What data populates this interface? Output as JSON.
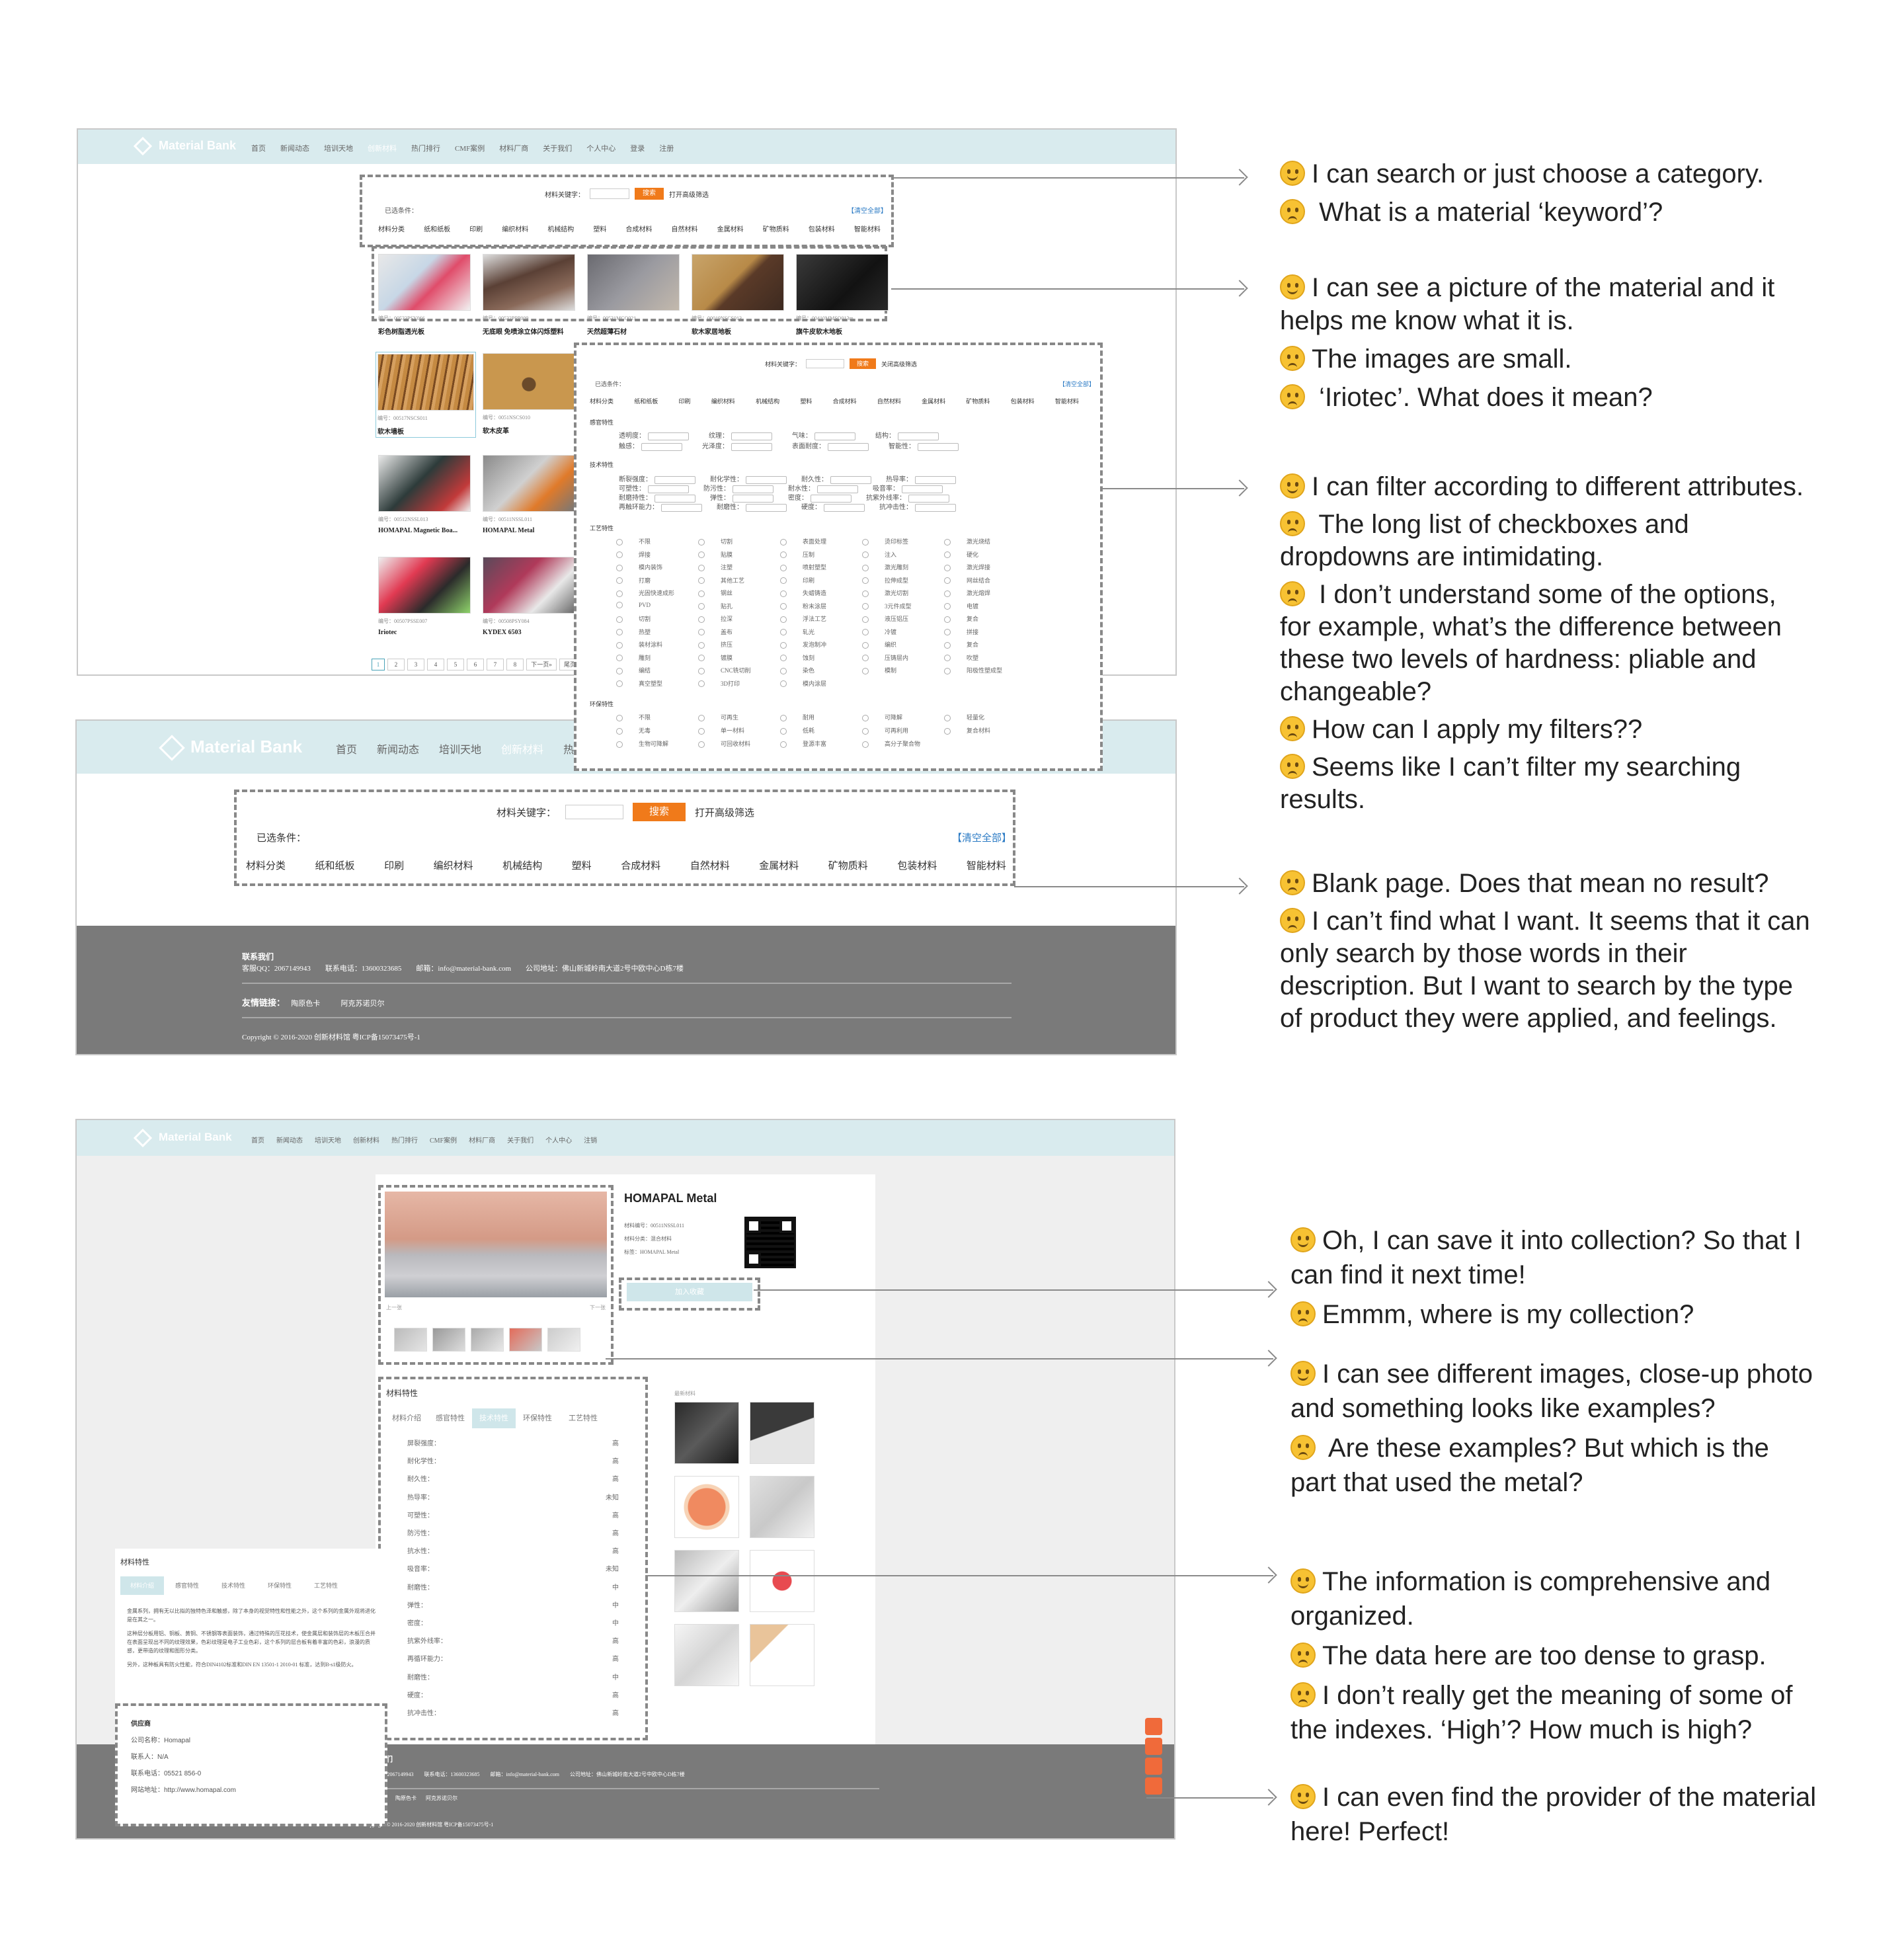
{
  "site": {
    "logo": "Material Bank",
    "nav": [
      "首页",
      "新闻动态",
      "培训天地",
      "创新材料",
      "热门排行",
      "CMF案例",
      "材料厂商",
      "关于我们",
      "个人中心",
      "登录",
      "注册"
    ],
    "nav_bottom": [
      "首页",
      "新闻动态",
      "培训天地",
      "创新材料",
      "热门排行",
      "CMF案例",
      "材料厂商",
      "关于我们",
      "个人中心",
      "注销"
    ]
  },
  "search": {
    "keyword_label": "材料关键字：",
    "button": "搜索",
    "advanced_open": "打开高级筛选",
    "advanced_close": "关闭高级筛选",
    "selected_label": "已选条件：",
    "clear_all": "【清空全部】",
    "categories": [
      "材料分类",
      "纸和纸板",
      "印刷",
      "编织材料",
      "机械结构",
      "塑料",
      "合成材料",
      "自然材料",
      "金属材料",
      "矿物质料",
      "包装材料",
      "智能材料"
    ]
  },
  "results": [
    {
      "code": "编号：00533PSY066",
      "name": "彩色树脂透光板"
    },
    {
      "code": "编号：00532PPP009",
      "name": "无底眼 免喷涂立体闪烁塑料"
    },
    {
      "code": "编号：00531MCO021",
      "name": "天然超薄石材"
    },
    {
      "code": "编号：00019NSCS013",
      "name": "软木家居地板"
    },
    {
      "code": "编号：00410MMSO013m",
      "name": "旗牛皮软木地板"
    },
    {
      "code": "编号：00517NSCS011",
      "name": "软木墙板"
    },
    {
      "code": "编号：0051NSCS010",
      "name": "软木皮革"
    },
    {
      "code": "编号：00512NSSL013",
      "name": "HOMAPAL Magnetic Boa..."
    },
    {
      "code": "编号：00511NSSL011",
      "name": "HOMAPAL Metal"
    },
    {
      "code": "编号：00507PSSE007",
      "name": "Iriotec"
    },
    {
      "code": "编号：00508PSY084",
      "name": "KYDEX 6503"
    }
  ],
  "pager": [
    "1",
    "2",
    "3",
    "4",
    "5",
    "6",
    "7",
    "8",
    "下一页»",
    "尾页"
  ],
  "filters": {
    "sensory_title": "感官特性",
    "sensory": [
      "透明度：",
      "纹理：",
      "气味：",
      "结构：",
      "触感：",
      "光泽度：",
      "表面耐度：",
      "智能性："
    ],
    "dropdown": "不限",
    "tech_title": "技术特性",
    "tech": [
      "断裂强度：",
      "耐化学性：",
      "耐久性：",
      "热导率：",
      "可塑性：",
      "防污性：",
      "耐水性：",
      "吸音率：",
      "耐磨持性：",
      "弹性：",
      "密度：",
      "抗紫外线率：",
      "再触环能力：",
      "耐磨性：",
      "硬度：",
      "抗冲击性："
    ],
    "process_title": "工艺特性",
    "process": [
      "不限",
      "切割",
      "表面处理",
      "烫印标签",
      "激光烧结",
      "焊接",
      "贴膜",
      "压制",
      "注入",
      "硬化",
      "模内装饰",
      "注塑",
      "喷射塑型",
      "激光雕刻",
      "激光焊接",
      "打磨",
      "其他工艺",
      "印刷",
      "拉伸成型",
      "网丝结合",
      "光固快速成形",
      "钢丝",
      "失蜡铸造",
      "激光切割",
      "激光熔焊",
      "PVD",
      "贴孔",
      "粉末涂层",
      "3元件成型",
      "电镀",
      "切割",
      "拉深",
      "浮法工艺",
      "液压铝压",
      "复合",
      "热塑",
      "盖布",
      "轧光",
      "冷镀",
      "拼接",
      "装材涂料",
      "挤压",
      "发泡制冲",
      "编织",
      "复合",
      "雕刻",
      "镀膜",
      "蚀刻",
      "压铸层内",
      "吹塑",
      "编结",
      "CNC铣切削",
      "染色",
      "模制",
      "阳极性塑成型",
      "真空塑型",
      "3D打印",
      "模内涂层"
    ],
    "eco_title": "环保特性",
    "eco": [
      "不限",
      "可再生",
      "耐用",
      "可降解",
      "轻量化",
      "无毒",
      "单一材料",
      "低耗",
      "可再利用",
      "复合材料",
      "生物可降解",
      "可回收材料",
      "登源丰富",
      "高分子聚合物"
    ]
  },
  "footer": {
    "title": "联系我们",
    "contact": "客服QQ：2067149943　　联系电话：13600323685　　邮箱：info@material-bank.com　　公司地址：佛山新城岭南大道2号中欧中心D栋7楼",
    "links_label": "友情链接：",
    "links": [
      "陶原色卡",
      "阿克苏诺贝尔"
    ],
    "copyright": "Copyright © 2016-2020 创新材料馆 粤ICP备15073475号-1"
  },
  "detail": {
    "title": "HOMAPAL Metal",
    "meta": [
      "材料编号：00511NSSL011",
      "材料分类：混合材料",
      "标签：HOMAPAL Metal"
    ],
    "save": "加入收藏",
    "prev": "上一张",
    "next": "下一张",
    "section_title": "材料特性",
    "tabs": [
      "材料介绍",
      "感官特性",
      "技术特性",
      "环保特性",
      "工艺特性"
    ],
    "props": [
      {
        "k": "屏裂强度：",
        "v": "高"
      },
      {
        "k": "耐化学性：",
        "v": "高"
      },
      {
        "k": "耐久性：",
        "v": "高"
      },
      {
        "k": "热导率：",
        "v": "未知"
      },
      {
        "k": "可塑性：",
        "v": "高"
      },
      {
        "k": "防污性：",
        "v": "高"
      },
      {
        "k": "抗水性：",
        "v": "高"
      },
      {
        "k": "吸音率：",
        "v": "未知"
      },
      {
        "k": "耐磨性：",
        "v": "中"
      },
      {
        "k": "弹性：",
        "v": "中"
      },
      {
        "k": "密度：",
        "v": "中"
      },
      {
        "k": "抗紫外线率：",
        "v": "高"
      },
      {
        "k": "再循环能力：",
        "v": "高"
      },
      {
        "k": "耐磨性：",
        "v": "中"
      },
      {
        "k": "硬度：",
        "v": "高"
      },
      {
        "k": "抗冲击性：",
        "v": "高"
      }
    ],
    "similar_title": "最新材料",
    "intro_text": "金属系列，拥有无以比拟的独特色泽和触感，除了本身的视觉特性和性能之外，这个系列的金属外观将进化是在其之一。",
    "intro_text2": "这种层分板用铝、铜板、黄铜、不锈钢等表面装饰，通过特殊的压花技术，使金属层和装饰层的木板压合并在表面呈现出不同的纹理效果，色彩纹理是电子工业色彩，这个系列的层合板有着丰富的色彩，浪漫的质感，更带造的纹理和图形分类。",
    "intro_text3": "另外，这种板具有防火性能，符合DIN4102标准和DIN EN 13501-1 2010-01 标准，达到B-s1级防火。",
    "supplier_title": "供应商",
    "supplier": [
      "公司名称：Homapal",
      "联系人：N/A",
      "联系电话：05521 856-0",
      "网站地址：http://www.homapal.com"
    ]
  },
  "notes": {
    "n1": [
      "I can search or just choose a category.",
      "What is a material ‘keyword’?"
    ],
    "n2": [
      "I can see a picture of the material and it",
      "helps me know what it is.",
      "The images are small.",
      "‘Iriotec’. What does it mean?"
    ],
    "n3": [
      "I can filter according to different attributes.",
      "The long list of checkboxes and",
      "dropdowns are intimidating.",
      "I don’t understand some of the options,",
      "for example, what’s the difference between",
      "these two levels of hardness:  pliable and",
      "changeable?",
      "How can I apply my filters??",
      "Seems like I can’t filter my searching",
      "results."
    ],
    "n4": [
      "Blank page. Does that mean no result?",
      "I can’t find what I want. It seems that it can",
      "only search by those words in their",
      "description. But I want to search by the type",
      "of product they were applied, and feelings."
    ],
    "n5": [
      "Oh, I can save it into collection? So that I",
      "can find it next time!",
      "Emmm, where is my collection?"
    ],
    "n6": [
      "I can see different images, close-up photo",
      "and something looks like examples?",
      "Are these examples? But which is the",
      "part that used the metal?"
    ],
    "n7": [
      "The information is comprehensive and",
      "organized.",
      "The data here are too dense to grasp.",
      "I don’t really get the meaning of some of",
      "the indexes. ‘High’? How much is high?"
    ],
    "n8": [
      "I can even find the provider of the material",
      "here! Perfect!"
    ]
  },
  "colors": {
    "header": "#d9ebee",
    "accent": "#f07a1a",
    "footer": "#7a7a7a",
    "link": "#2a7ac4",
    "sidebar_button": "#f06a3a"
  }
}
